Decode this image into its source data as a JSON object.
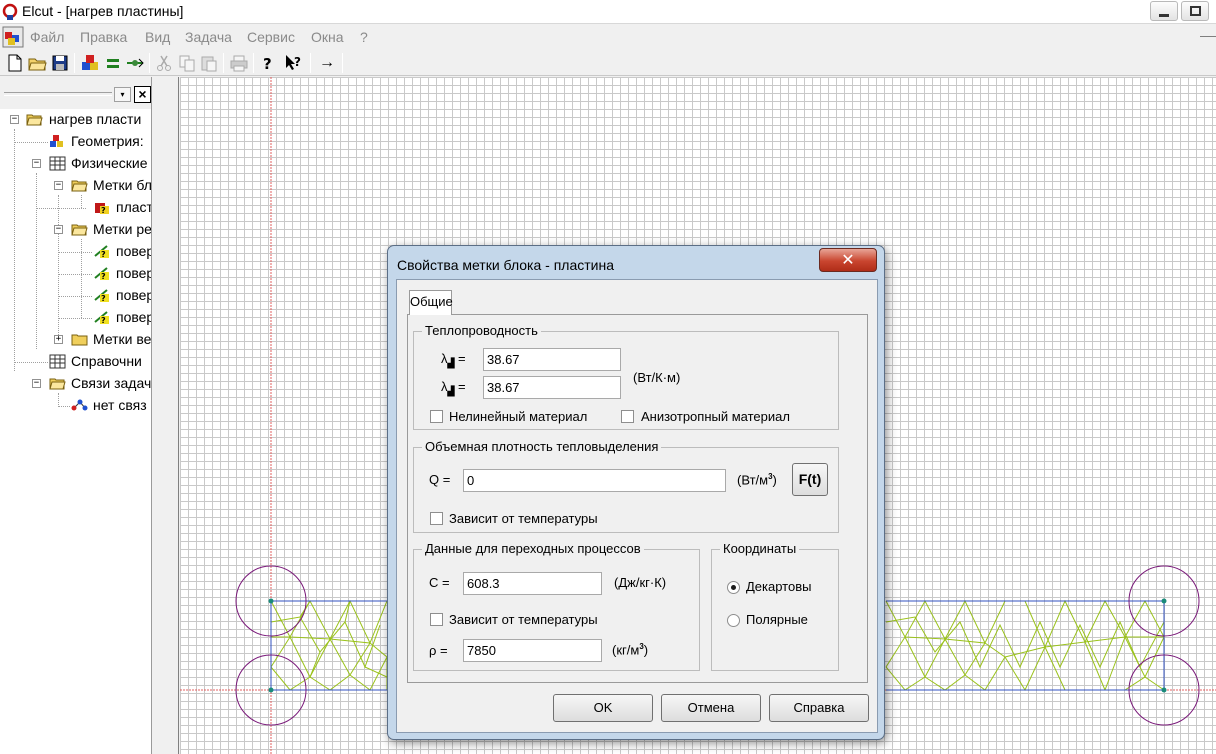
{
  "window": {
    "title": "Elcut - [нагрев пластины]"
  },
  "menu": [
    "Файл",
    "Правка",
    "Вид",
    "Задача",
    "Сервис",
    "Окна",
    "?"
  ],
  "toolbar": {
    "icons": [
      "new-file-icon",
      "open-folder-icon",
      "save-icon",
      "geometry-icon",
      "equals-icon",
      "connect-icon",
      "cut-icon",
      "copy-icon",
      "paste-icon",
      "print-icon",
      "help-icon",
      "context-help-icon",
      "arrow-right-icon"
    ],
    "arrow_glyph": "→"
  },
  "tree": {
    "items": [
      {
        "label": "нагрев пласти",
        "icon": "folder-open-icon",
        "level": 0
      },
      {
        "label": "Геометрия:",
        "icon": "geometry-icon",
        "level": 1
      },
      {
        "label": "Физические",
        "icon": "table-icon",
        "level": 1
      },
      {
        "label": "Метки бл",
        "icon": "folder-open-icon",
        "level": 2
      },
      {
        "label": "пласт",
        "icon": "block-label-icon",
        "level": 3
      },
      {
        "label": "Метки ре",
        "icon": "folder-open-icon",
        "level": 2
      },
      {
        "label": "повер",
        "icon": "edge-label-icon",
        "level": 3
      },
      {
        "label": "повер",
        "icon": "edge-label-icon",
        "level": 3
      },
      {
        "label": "повер",
        "icon": "edge-label-icon",
        "level": 3
      },
      {
        "label": "повер",
        "icon": "edge-label-icon",
        "level": 3
      },
      {
        "label": "Метки ве",
        "icon": "folder-closed-icon",
        "level": 2
      },
      {
        "label": "Справочни",
        "icon": "table-icon",
        "level": 1
      },
      {
        "label": "Связи задач",
        "icon": "folder-open-icon",
        "level": 1
      },
      {
        "label": "нет связ",
        "icon": "link-icon",
        "level": 2
      }
    ]
  },
  "dialog": {
    "title": "Свойства метки блока - пластина",
    "close_glyph": "✕",
    "tab": "Общие",
    "conductivity": {
      "title": "Теплопроводность",
      "lambda_x_label": "λ",
      "lambda_y_label": "λ",
      "lambda_x": "38.67",
      "lambda_y": "38.67",
      "unit": "(Вт/К·м)",
      "nonlinear_label": "Нелинейный материал",
      "anisotropic_label": "Анизотропный материал"
    },
    "heat_source": {
      "title": "Объемная плотность тепловыделения",
      "q_label": "Q =",
      "q_value": "0",
      "unit_base": "(Вт/м",
      "unit_exp": "3",
      "unit_close": ")",
      "ft_button": "F(t)",
      "temp_dep_label": "Зависит от температуры"
    },
    "transient": {
      "title": "Данные для переходных процессов",
      "c_label": "C =",
      "c_value": "608.3",
      "c_unit": "(Дж/кг·К)",
      "temp_dep_label": "Зависит от температуры",
      "rho_label": "ρ =",
      "rho_value": "7850",
      "rho_unit_base": "(кг/м",
      "rho_unit_exp": "3",
      "rho_unit_close": ")"
    },
    "coordinates": {
      "title": "Координаты",
      "cartesian": "Декартовы",
      "polar": "Полярные",
      "selected": "Декартовы"
    },
    "buttons": {
      "ok": "OK",
      "cancel": "Отмена",
      "help": "Справка"
    }
  },
  "colors": {
    "mesh": "#9ac21a",
    "circle": "#7a1a7a",
    "axis": "#e06060",
    "node": "#1a8a7a",
    "border": "#3050c0"
  }
}
